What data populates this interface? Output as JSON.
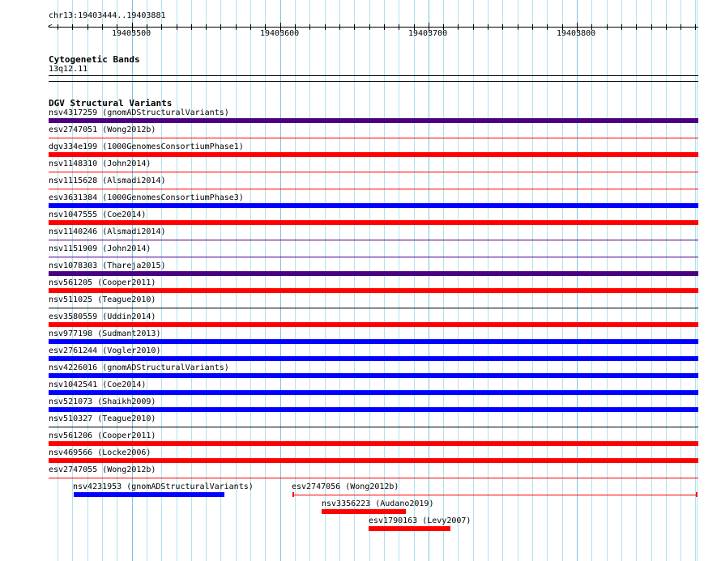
{
  "ruler": {
    "location": "chr13:19403444..19403881",
    "tick_labels": [
      "19403500",
      "19403600",
      "19403700",
      "19403800"
    ]
  },
  "cytobands": {
    "title": "Cytogenetic Bands",
    "band": "13q12.11"
  },
  "dgv": {
    "title": "DGV Structural Variants",
    "colors": {
      "purple": "#4b0082",
      "red": "#ff0000",
      "blue": "#0000ff",
      "black": "#000000"
    },
    "rows": [
      {
        "label": "nsv4317259 (gnomADStructuralVariants)",
        "color": "purple",
        "style": "thick"
      },
      {
        "label": "esv2747051 (Wong2012b)",
        "color": "red",
        "style": "thin"
      },
      {
        "label": "dgv334e199 (1000GenomesConsortiumPhase1)",
        "color": "red",
        "style": "thick"
      },
      {
        "label": "nsv1148310 (John2014)",
        "color": "red",
        "style": "thin"
      },
      {
        "label": "nsv1115628 (Alsmadi2014)",
        "color": "red",
        "style": "thin"
      },
      {
        "label": "esv3631384 (1000GenomesConsortiumPhase3)",
        "color": "blue",
        "style": "thick"
      },
      {
        "label": "nsv1047555 (Coe2014)",
        "color": "red",
        "style": "thick"
      },
      {
        "label": "nsv1140246 (Alsmadi2014)",
        "color": "purple",
        "style": "thin"
      },
      {
        "label": "nsv1151909 (John2014)",
        "color": "purple",
        "style": "thin"
      },
      {
        "label": "nsv1078303 (Thareja2015)",
        "color": "purple",
        "style": "thick"
      },
      {
        "label": "nsv561205 (Cooper2011)",
        "color": "red",
        "style": "thick"
      },
      {
        "label": "nsv511025 (Teague2010)",
        "color": "black",
        "style": "thin"
      },
      {
        "label": "esv3580559 (Uddin2014)",
        "color": "red",
        "style": "thick"
      },
      {
        "label": "nsv977198 (Sudmant2013)",
        "color": "blue",
        "style": "thick"
      },
      {
        "label": "esv2761244 (Vogler2010)",
        "color": "blue",
        "style": "thick"
      },
      {
        "label": "nsv4226016 (gnomADStructuralVariants)",
        "color": "blue",
        "style": "thick"
      },
      {
        "label": "nsv1042541 (Coe2014)",
        "color": "blue",
        "style": "thick"
      },
      {
        "label": "nsv521073 (Shaikh2009)",
        "color": "blue",
        "style": "thick"
      },
      {
        "label": "nsv510327 (Teague2010)",
        "color": "black",
        "style": "thin"
      },
      {
        "label": "nsv561206 (Cooper2011)",
        "color": "red",
        "style": "thick"
      },
      {
        "label": "nsv469566 (Locke2006)",
        "color": "red",
        "style": "thick"
      },
      {
        "label": "esv2747055 (Wong2012b)",
        "color": "red",
        "style": "thin"
      }
    ],
    "partial": [
      {
        "label": "nsv4231953 (gnomADStructuralVariants)",
        "color": "blue",
        "style": "thick"
      },
      {
        "label": "esv2747056 (Wong2012b)",
        "color": "red",
        "style": "thin"
      },
      {
        "label": "nsv3356223 (Audano2019)",
        "color": "red",
        "style": "thick"
      },
      {
        "label": "esv1790163 (Levy2007)",
        "color": "red",
        "style": "thick"
      }
    ]
  }
}
